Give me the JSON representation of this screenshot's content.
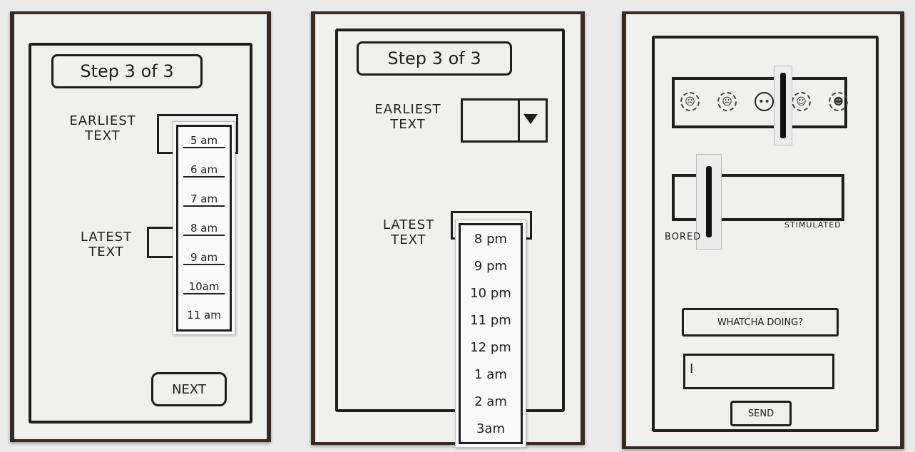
{
  "screen1": {
    "step_title": "Step 3 of 3",
    "earliest_label_line1": "EARLIEST",
    "earliest_label_line2": "TEXT",
    "latest_label_line1": "LATEST",
    "latest_label_line2": "TEXT",
    "earliest_options": [
      "5 am",
      "6 am",
      "7 am",
      "8 am",
      "9 am",
      "10am",
      "11 am"
    ],
    "next_label": "NEXT"
  },
  "screen2": {
    "step_title": "Step 3 of 3",
    "earliest_label_line1": "EARLIEST",
    "earliest_label_line2": "TEXT",
    "latest_label_line1": "LATEST",
    "latest_label_line2": "TEXT",
    "latest_options": [
      "8 pm",
      "9 pm",
      "10 pm",
      "11 pm",
      "12 pm",
      "1 am",
      "2 am",
      "3am"
    ]
  },
  "screen3": {
    "mood_faces": [
      "very-sad-face-icon",
      "sad-face-icon",
      "neutral-face-icon",
      "happy-face-icon",
      "very-happy-face-icon"
    ],
    "mood_level": 0.65,
    "energy_level": 0.22,
    "energy_min_label": "BORED",
    "energy_max_label": "STIMULATED",
    "prompt_label": "WHATCHA DOING?",
    "text_input_value": "",
    "send_label": "SEND"
  },
  "colors": {
    "ink": "#1e1e1e",
    "paper": "#f0f0ee",
    "background": "#eaeaea",
    "photo_edge": "#3a2a22"
  }
}
